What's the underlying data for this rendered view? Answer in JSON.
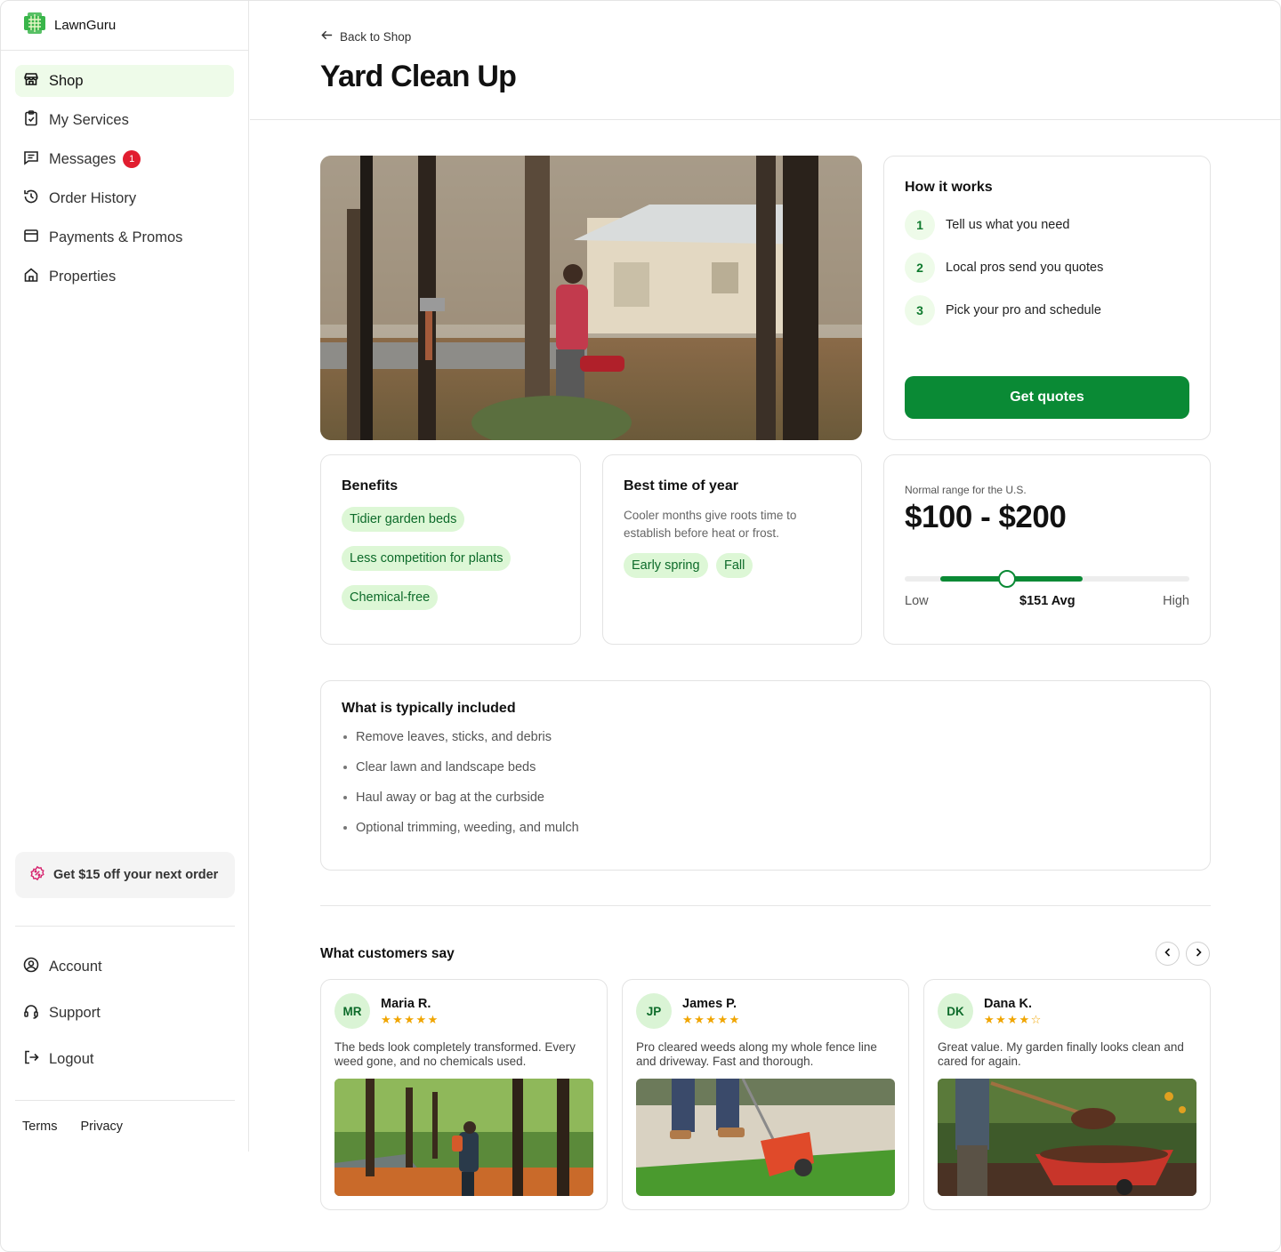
{
  "brand": {
    "name": "LawnGuru"
  },
  "sidebar": {
    "items": [
      {
        "label": "Shop",
        "active": true
      },
      {
        "label": "My Services"
      },
      {
        "label": "Messages",
        "badge": "1"
      },
      {
        "label": "Order History"
      },
      {
        "label": "Payments & Promos"
      },
      {
        "label": "Properties"
      }
    ],
    "promo": "Get $15 off your next order",
    "bottom_items": [
      {
        "label": "Account"
      },
      {
        "label": "Support"
      },
      {
        "label": "Logout"
      }
    ],
    "legal": {
      "terms": "Terms",
      "privacy": "Privacy"
    }
  },
  "header": {
    "back_label": "Back to Shop",
    "title": "Yard Clean Up"
  },
  "how_it_works": {
    "title": "How it works",
    "steps": [
      {
        "num": "1",
        "text": "Tell us what you need"
      },
      {
        "num": "2",
        "text": "Local pros send you quotes"
      },
      {
        "num": "3",
        "text": "Pick your pro and schedule"
      }
    ],
    "cta": "Get quotes"
  },
  "benefits": {
    "title": "Benefits",
    "chips": [
      "Tidier garden beds",
      "Less competition for plants",
      "Chemical-free"
    ]
  },
  "best_time": {
    "title": "Best time of year",
    "description": "Cooler months give roots time to establish before heat or frost.",
    "chips": [
      "Early spring",
      "Fall"
    ]
  },
  "price": {
    "caption": "Normal range for the U.S.",
    "range": "$100 - $200",
    "low_label": "Low",
    "avg_label": "$151 Avg",
    "high_label": "High",
    "range_fill_start": 0.125,
    "range_fill_end": 0.625,
    "avg_position": 0.36
  },
  "included": {
    "title": "What is typically included",
    "items": [
      "Remove leaves, sticks, and debris",
      "Clear lawn and landscape beds",
      "Haul away or bag at the curbside",
      "Optional trimming, weeding, and mulch"
    ]
  },
  "reviews": {
    "title": "What customers say",
    "items": [
      {
        "initials": "MR",
        "name": "Maria R.",
        "stars": "★★★★★",
        "text": "The beds look completely transformed. Every weed gone, and no chemicals used."
      },
      {
        "initials": "JP",
        "name": "James P.",
        "stars": "★★★★★",
        "text": "Pro cleared weeds along my whole fence line and driveway. Fast and thorough."
      },
      {
        "initials": "DK",
        "name": "Dana K.",
        "stars": "★★★★☆",
        "text": "Great value. My garden finally looks clean and cared for again."
      }
    ]
  },
  "colors": {
    "accent": "#0a8a35",
    "chip_bg": "#ddf7d6",
    "active_nav": "#eefbe9",
    "badge": "#e11d2f",
    "star": "#f0a500"
  }
}
